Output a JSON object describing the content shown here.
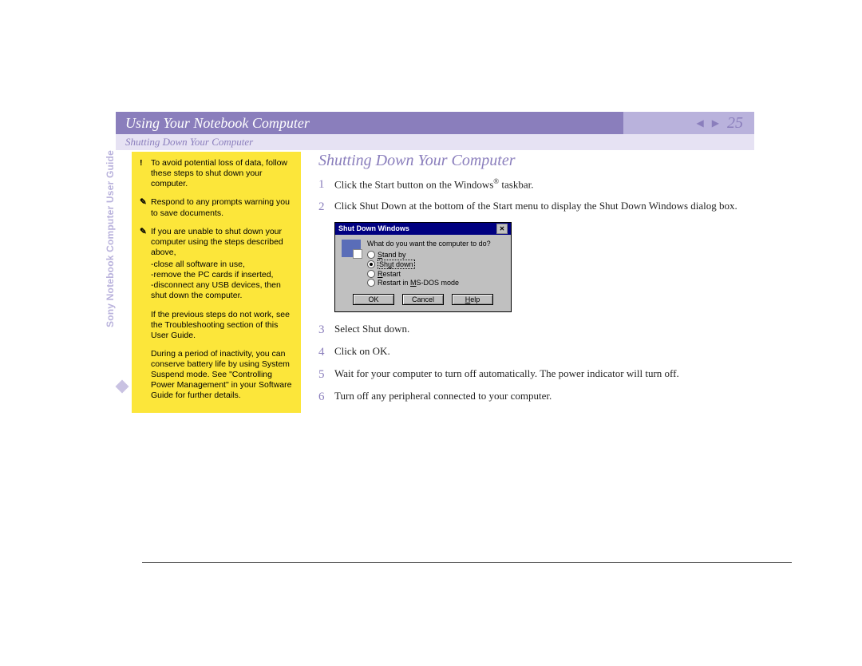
{
  "header": {
    "chapter": "Using Your Notebook Computer",
    "page_number": "25",
    "subsection": "Shutting Down Your Computer"
  },
  "side_label": "Sony Notebook Computer User Guide",
  "section_title": "Shutting Down Your Computer",
  "notes": [
    {
      "icon": "!",
      "text": "To avoid potential loss of data, follow these steps to shut down your computer."
    },
    {
      "icon": "✎",
      "text": "Respond to any prompts warning you to save documents."
    },
    {
      "icon": "✎",
      "text": "If you are unable to shut down your computer using the steps described above,"
    },
    {
      "icon": "",
      "text": "-close all software in use,\n-remove the PC cards if inserted,\n-disconnect any USB devices, then shut down the computer."
    },
    {
      "icon": "",
      "text": "If the previous steps do not work, see the Troubleshooting section of this User Guide."
    },
    {
      "icon": "",
      "text": "During a period of inactivity, you can conserve battery life by using System Suspend mode. See \"Controlling Power Management\" in your Software Guide for further details."
    }
  ],
  "steps": [
    {
      "n": "1",
      "html": "Click the Start button on the Windows<sup>®</sup> taskbar."
    },
    {
      "n": "2",
      "html": "Click Shut Down at the bottom of the Start menu to display the Shut Down Windows dialog box."
    },
    {
      "n": "3",
      "html": "Select Shut down."
    },
    {
      "n": "4",
      "html": "Click on OK."
    },
    {
      "n": "5",
      "html": "Wait for your computer to turn off automatically.  The power indicator will turn off."
    },
    {
      "n": "6",
      "html": "Turn off any peripheral connected to your computer."
    }
  ],
  "dialog": {
    "title": "Shut Down Windows",
    "question": "What do you want the computer to do?",
    "options": [
      {
        "label": "Stand by",
        "u": 0,
        "selected": false
      },
      {
        "label": "Shut down",
        "u": 0,
        "selected": true
      },
      {
        "label": "Restart",
        "u": 0,
        "selected": false
      },
      {
        "label": "Restart in MS-DOS mode",
        "u": 11,
        "selected": false
      }
    ],
    "buttons": {
      "ok": "OK",
      "cancel": "Cancel",
      "help": "Help"
    }
  }
}
